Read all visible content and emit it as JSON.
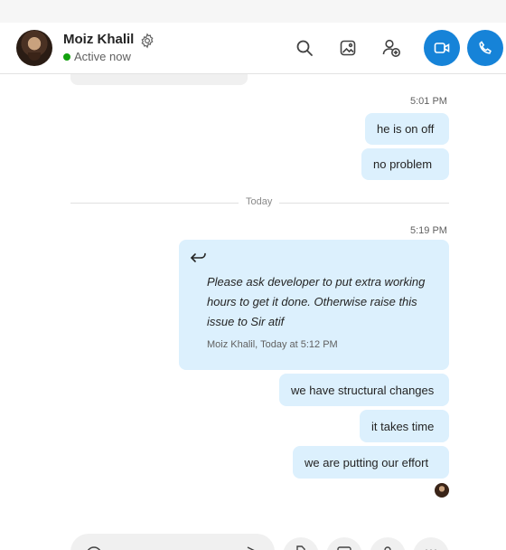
{
  "contact": {
    "name": "Moiz Khalil",
    "status": "Active now",
    "status_color": "#13a10e"
  },
  "header_actions": [
    {
      "name": "search-icon"
    },
    {
      "name": "gallery-icon"
    },
    {
      "name": "add-people-icon"
    },
    {
      "name": "video-call-icon"
    },
    {
      "name": "audio-call-icon"
    }
  ],
  "accent_color": "#1683d8",
  "bubble_color": "#dcf0fd",
  "messages": {
    "time_1": "5:01 PM",
    "msg_1": "he is on off",
    "msg_2": "no problem",
    "day_divider": "Today",
    "time_2": "5:19 PM",
    "quote": {
      "text": "Please ask developer to put extra working hours to get it done. Otherwise raise this issue to Sir atif",
      "meta": "Moiz Khalil, Today at 5:12 PM"
    },
    "msg_3": "we have structural changes",
    "msg_4": "it takes time",
    "msg_5": "we are putting our effort"
  }
}
